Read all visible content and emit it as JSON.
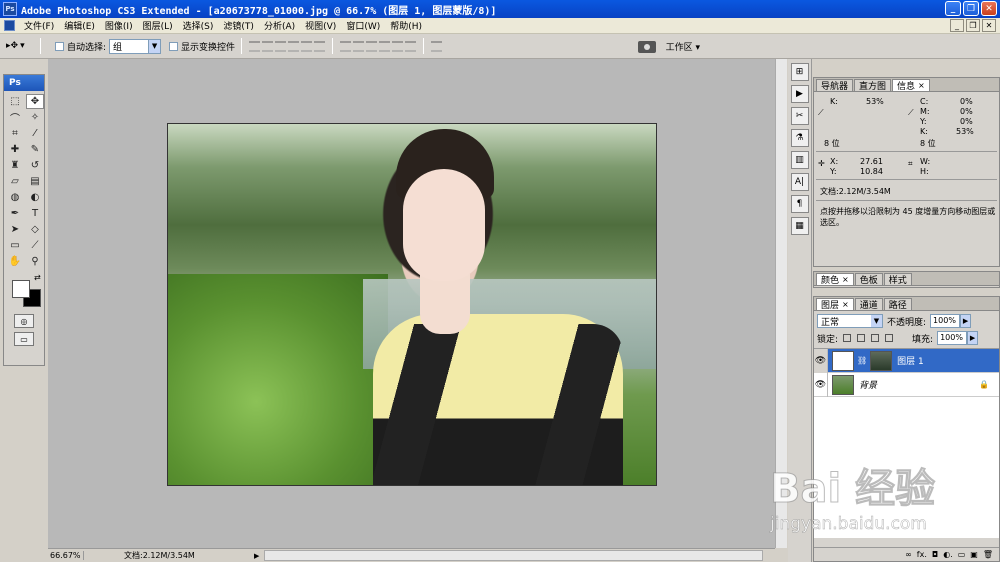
{
  "titlebar": {
    "title": "Adobe Photoshop CS3 Extended - [a20673778_01000.jpg @ 66.7% (图层 1, 图层蒙版/8)]",
    "logo": "Ps",
    "minimize": "_",
    "maximize": "❐",
    "close": "✕"
  },
  "menubar": {
    "items": [
      "文件(F)",
      "编辑(E)",
      "图像(I)",
      "图层(L)",
      "选择(S)",
      "滤镜(T)",
      "分析(A)",
      "视图(V)",
      "窗口(W)",
      "帮助(H)"
    ],
    "mdi_minimize": "_",
    "mdi_restore": "❐",
    "mdi_close": "✕"
  },
  "options": {
    "tool_glyph": "▸✥",
    "tool_arrow": "▾",
    "auto_select_label": "自动选择:",
    "auto_select_value": "组",
    "show_transform_label": "显示变换控件",
    "workspace_label": "工作区 ▾"
  },
  "toolbox": {
    "header": "Ps",
    "tools": [
      {
        "name": "marquee-tool",
        "glyph": "⬚"
      },
      {
        "name": "move-tool",
        "glyph": "✥"
      },
      {
        "name": "lasso-tool",
        "glyph": "⌒"
      },
      {
        "name": "magic-wand-tool",
        "glyph": "✧"
      },
      {
        "name": "crop-tool",
        "glyph": "⌗"
      },
      {
        "name": "slice-tool",
        "glyph": "⁄"
      },
      {
        "name": "healing-brush-tool",
        "glyph": "✚"
      },
      {
        "name": "brush-tool",
        "glyph": "✎"
      },
      {
        "name": "clone-stamp-tool",
        "glyph": "♜"
      },
      {
        "name": "history-brush-tool",
        "glyph": "↺"
      },
      {
        "name": "eraser-tool",
        "glyph": "▱"
      },
      {
        "name": "gradient-tool",
        "glyph": "▤"
      },
      {
        "name": "blur-tool",
        "glyph": "◍"
      },
      {
        "name": "dodge-tool",
        "glyph": "◐"
      },
      {
        "name": "pen-tool",
        "glyph": "✒"
      },
      {
        "name": "type-tool",
        "glyph": "T"
      },
      {
        "name": "path-selection-tool",
        "glyph": "➤"
      },
      {
        "name": "shape-tool",
        "glyph": "◇"
      },
      {
        "name": "notes-tool",
        "glyph": "▭"
      },
      {
        "name": "eyedropper-tool",
        "glyph": "⟋"
      },
      {
        "name": "hand-tool",
        "glyph": "✋"
      },
      {
        "name": "zoom-tool",
        "glyph": "⚲"
      }
    ],
    "swap_glyph": "⇄",
    "quickmask_glyph": "◎",
    "screenmode_glyph": "▭"
  },
  "dock": {
    "icons": [
      "⊞",
      "▶",
      "✂",
      "⚗",
      "▥",
      "A|",
      "¶",
      "▦"
    ]
  },
  "info_panel": {
    "tabs": [
      "导航器",
      "直方图",
      "信息"
    ],
    "close_glyph": "×",
    "k_label": "K:",
    "k_value": "53%",
    "c_label": "C:",
    "c_value": "0%",
    "m_label": "M:",
    "m_value": "0%",
    "y_label": "Y:",
    "y_value": "0%",
    "k2_label": "K:",
    "k2_value": "53%",
    "bits_left": "8 位",
    "bits_right": "8 位",
    "x_label": "X:",
    "x_value": "27.61",
    "ypos_label": "Y:",
    "ypos_value": "10.84",
    "w_label": "W:",
    "h_label": "H:",
    "doc_size": "文档:2.12M/3.54M",
    "hint": "点按并拖移以沿限制为 45 度增量方向移动图层或选区。"
  },
  "color_panel": {
    "tabs": [
      "颜色",
      "色板",
      "样式"
    ]
  },
  "layers_panel": {
    "tabs": [
      "图层",
      "通道",
      "路径"
    ],
    "blend_mode": "正常",
    "opacity_label": "不透明度:",
    "opacity_value": "100%",
    "lock_label": "锁定:",
    "fill_label": "填充:",
    "fill_value": "100%",
    "layers": [
      {
        "name": "图层 1",
        "selected": true
      },
      {
        "name": "背景",
        "selected": false,
        "locked": true
      }
    ],
    "footer_icons": [
      "∞",
      "fx.",
      "◘",
      "◐.",
      "▭",
      "▣",
      "🗑"
    ]
  },
  "statusbar": {
    "zoom": "66.67%",
    "doc_size": "文档:2.12M/3.54M",
    "menu_arrow": "▶"
  },
  "watermark": {
    "logo": "Bai 经验",
    "url": "jingyan.baidu.com"
  }
}
